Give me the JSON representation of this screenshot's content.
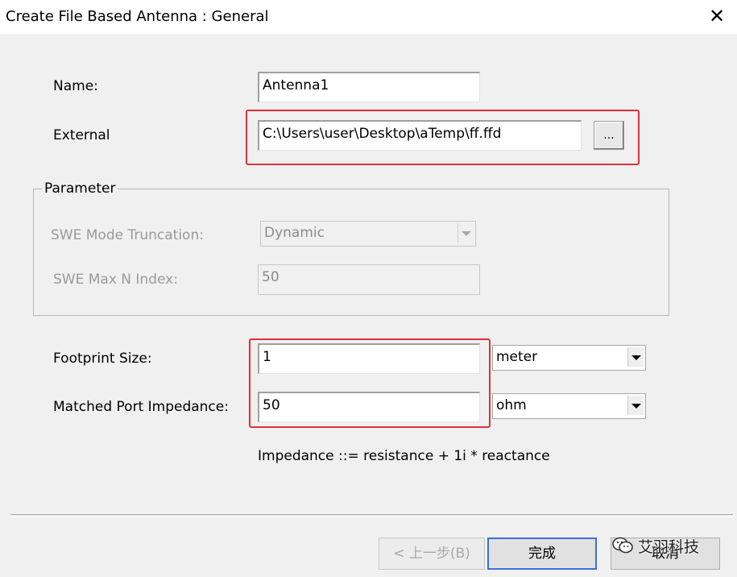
{
  "window": {
    "title": "Create File Based Antenna : General",
    "close_glyph": "✕"
  },
  "form": {
    "name_label": "Name:",
    "name_value": "Antenna1",
    "external_label": "External",
    "external_value": "C:\\Users\\user\\Desktop\\aTemp\\ff.ffd",
    "browse_label": "..."
  },
  "parameter": {
    "group_label": "Parameter",
    "swe_trunc_label": "SWE Mode Truncation:",
    "swe_trunc_value": "Dynamic",
    "swe_max_label": "SWE Max N Index:",
    "swe_max_value": "50"
  },
  "footprint": {
    "label": "Footprint Size:",
    "value": "1",
    "unit": "meter"
  },
  "impedance": {
    "label": "Matched Port Impedance:",
    "value": "50",
    "unit": "ohm",
    "note": "Impedance ::= resistance + 1i * reactance"
  },
  "buttons": {
    "back": "< 上一步(B)",
    "finish": "完成",
    "cancel": "取消"
  },
  "watermark": {
    "text": "艾羽科技",
    "icon": "wechat-icon"
  },
  "colors": {
    "highlight": "#e0303a",
    "default_button": "#3a6fd8"
  }
}
